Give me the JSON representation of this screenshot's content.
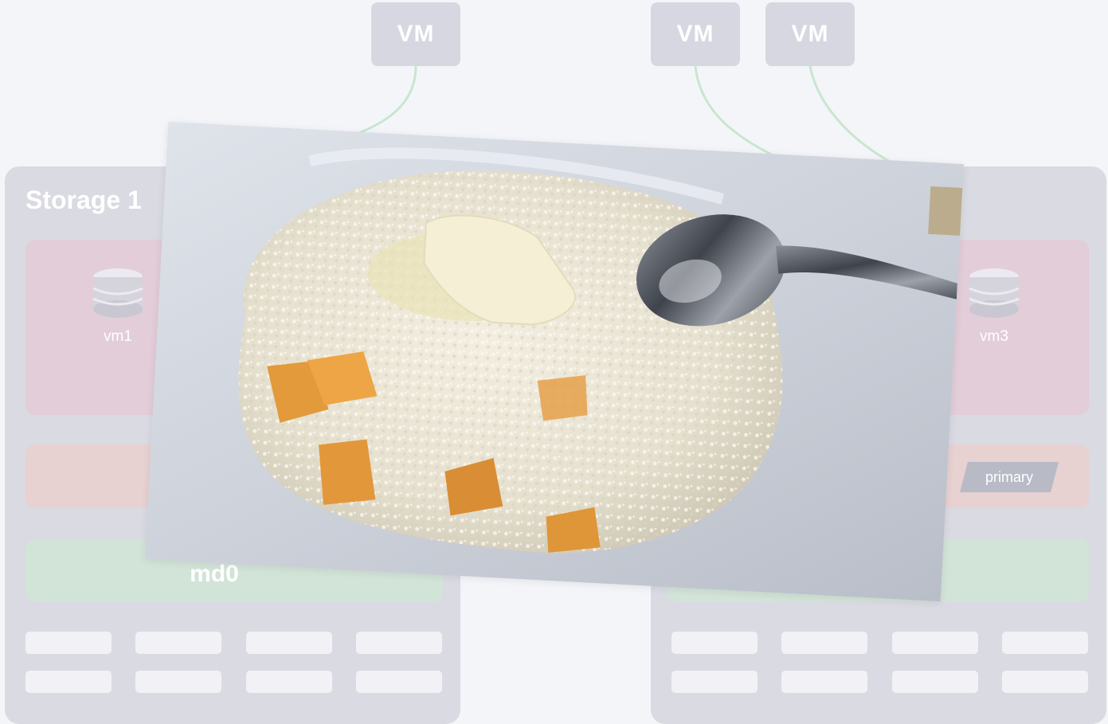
{
  "vm_nodes": [
    {
      "label": "VM"
    },
    {
      "label": "VM"
    },
    {
      "label": "VM"
    }
  ],
  "storage_left": {
    "title": "Storage 1",
    "vm_volume_label": "vm1",
    "md_label": "md0"
  },
  "storage_right": {
    "vm_volume_label": "vm3",
    "role_label": "primary"
  },
  "photo": {
    "subject": "bowl of porridge with butter, pumpkin pieces and a spoon",
    "icon": "food-photo"
  },
  "colors": {
    "background": "#f4f5f9",
    "vm_box": "#d6d7e0",
    "storage": "#d9dae2",
    "vm_area": "#e2cdd8",
    "raid_area": "#e7d1d1",
    "md_area": "#d2e3d7",
    "connector": "#c8e6cf"
  }
}
